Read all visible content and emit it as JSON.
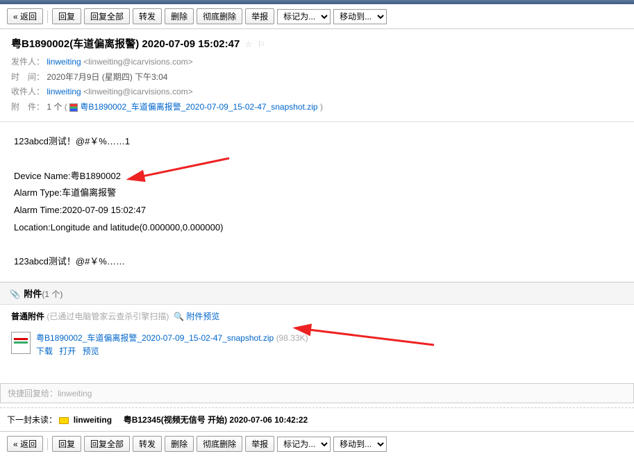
{
  "toolbar": {
    "back": "« 返回",
    "reply": "回复",
    "reply_all": "回复全部",
    "forward": "转发",
    "delete": "删除",
    "purge": "彻底删除",
    "spam": "举报",
    "mark_as": "标记为...",
    "move_to": "移动到..."
  },
  "subject": "粤B1890002(车道偏离报警) 2020-07-09 15:02:47",
  "headers": {
    "from_label": "发件人：",
    "from_name": "linweiting",
    "from_email": "<linweiting@icarvisions.com>",
    "time_label": "时　间：",
    "time_value": "2020年7月9日 (星期四) 下午3:04",
    "to_label": "收件人：",
    "to_name": "linweiting",
    "to_email": "<linweiting@icarvisions.com>",
    "att_label": "附　件：",
    "att_count": "1 个",
    "att_name": "粤B1890002_车道偏离报警_2020-07-09_15-02-47_snapshot.zip"
  },
  "body": {
    "line1": "123abcd测试！@#￥%……1",
    "line2": "Device Name:粤B1890002",
    "line3": "Alarm Type:车道偏离报警",
    "line4": "Alarm Time:2020-07-09 15:02:47",
    "line5": "Location:Longitude and latitude(0.000000,0.000000)",
    "line6": "123abcd测试！@#￥%……"
  },
  "attachments": {
    "section_title": "附件",
    "section_count": "(1 个)",
    "normal_label": "普通附件",
    "scan_note": "(已通过电脑管家云查杀引擎扫描)",
    "preview_link": "附件预览",
    "file_name": "粤B1890002_车道偏离报警_2020-07-09_15-02-47_snapshot.zip",
    "file_size": "(98.33K)",
    "action_download": "下载",
    "action_open": "打开",
    "action_preview": "预览"
  },
  "quick_reply": {
    "prefix": "快捷回复给：",
    "name": "linweiting"
  },
  "next": {
    "label": "下一封未读：",
    "from": "linweiting",
    "subject": "粤B12345(视频无信号 开始) 2020-07-06 10:42:22"
  }
}
